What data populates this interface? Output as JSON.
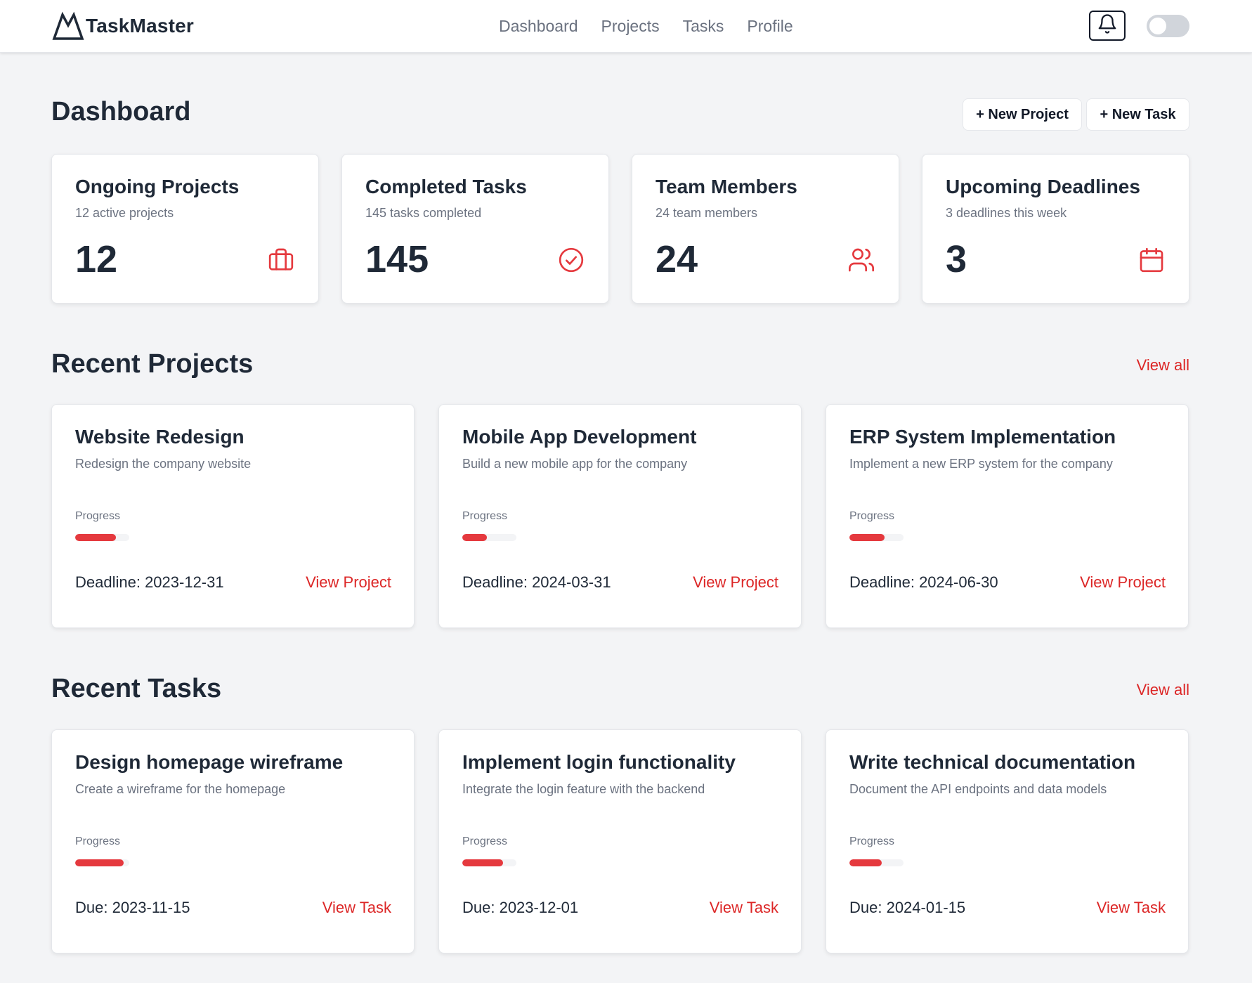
{
  "app": {
    "name": "TaskMaster",
    "logo_icon": "mountain-logo-icon"
  },
  "nav": {
    "items": [
      "Dashboard",
      "Projects",
      "Tasks",
      "Profile"
    ]
  },
  "header": {
    "notifications_icon": "bell-icon",
    "theme_toggle_on": false
  },
  "page": {
    "title": "Dashboard",
    "new_project_label": "+ New Project",
    "new_task_label": "+ New Task"
  },
  "stats": [
    {
      "title": "Ongoing Projects",
      "subtitle": "12 active projects",
      "value": "12",
      "icon": "briefcase-icon"
    },
    {
      "title": "Completed Tasks",
      "subtitle": "145 tasks completed",
      "value": "145",
      "icon": "check-circle-icon"
    },
    {
      "title": "Team Members",
      "subtitle": "24 team members",
      "value": "24",
      "icon": "users-icon"
    },
    {
      "title": "Upcoming Deadlines",
      "subtitle": "3 deadlines this week",
      "value": "3",
      "icon": "calendar-icon"
    }
  ],
  "recent_projects": {
    "title": "Recent Projects",
    "view_all": "View all",
    "items": [
      {
        "title": "Website Redesign",
        "description": "Redesign the company website",
        "progress_label": "Progress",
        "progress": 0.75,
        "date": "Deadline: 2023-12-31",
        "link": "View Project"
      },
      {
        "title": "Mobile App Development",
        "description": "Build a new mobile app for the company",
        "progress_label": "Progress",
        "progress": 0.45,
        "date": "Deadline: 2024-03-31",
        "link": "View Project"
      },
      {
        "title": "ERP System Implementation",
        "description": "Implement a new ERP system for the company",
        "progress_label": "Progress",
        "progress": 0.65,
        "date": "Deadline: 2024-06-30",
        "link": "View Project"
      }
    ]
  },
  "recent_tasks": {
    "title": "Recent Tasks",
    "view_all": "View all",
    "items": [
      {
        "title": "Design homepage wireframe",
        "description": "Create a wireframe for the homepage",
        "progress_label": "Progress",
        "progress": 0.9,
        "date": "Due: 2023-11-15",
        "link": "View Task"
      },
      {
        "title": "Implement login functionality",
        "description": "Integrate the login feature with the backend",
        "progress_label": "Progress",
        "progress": 0.75,
        "date": "Due: 2023-12-01",
        "link": "View Task"
      },
      {
        "title": "Write technical documentation",
        "description": "Document the API endpoints and data models",
        "progress_label": "Progress",
        "progress": 0.6,
        "date": "Due: 2024-01-15",
        "link": "View Task"
      }
    ]
  },
  "colors": {
    "accent": "#dc2626",
    "progress": "#e5393e",
    "background": "#f3f4f6"
  }
}
